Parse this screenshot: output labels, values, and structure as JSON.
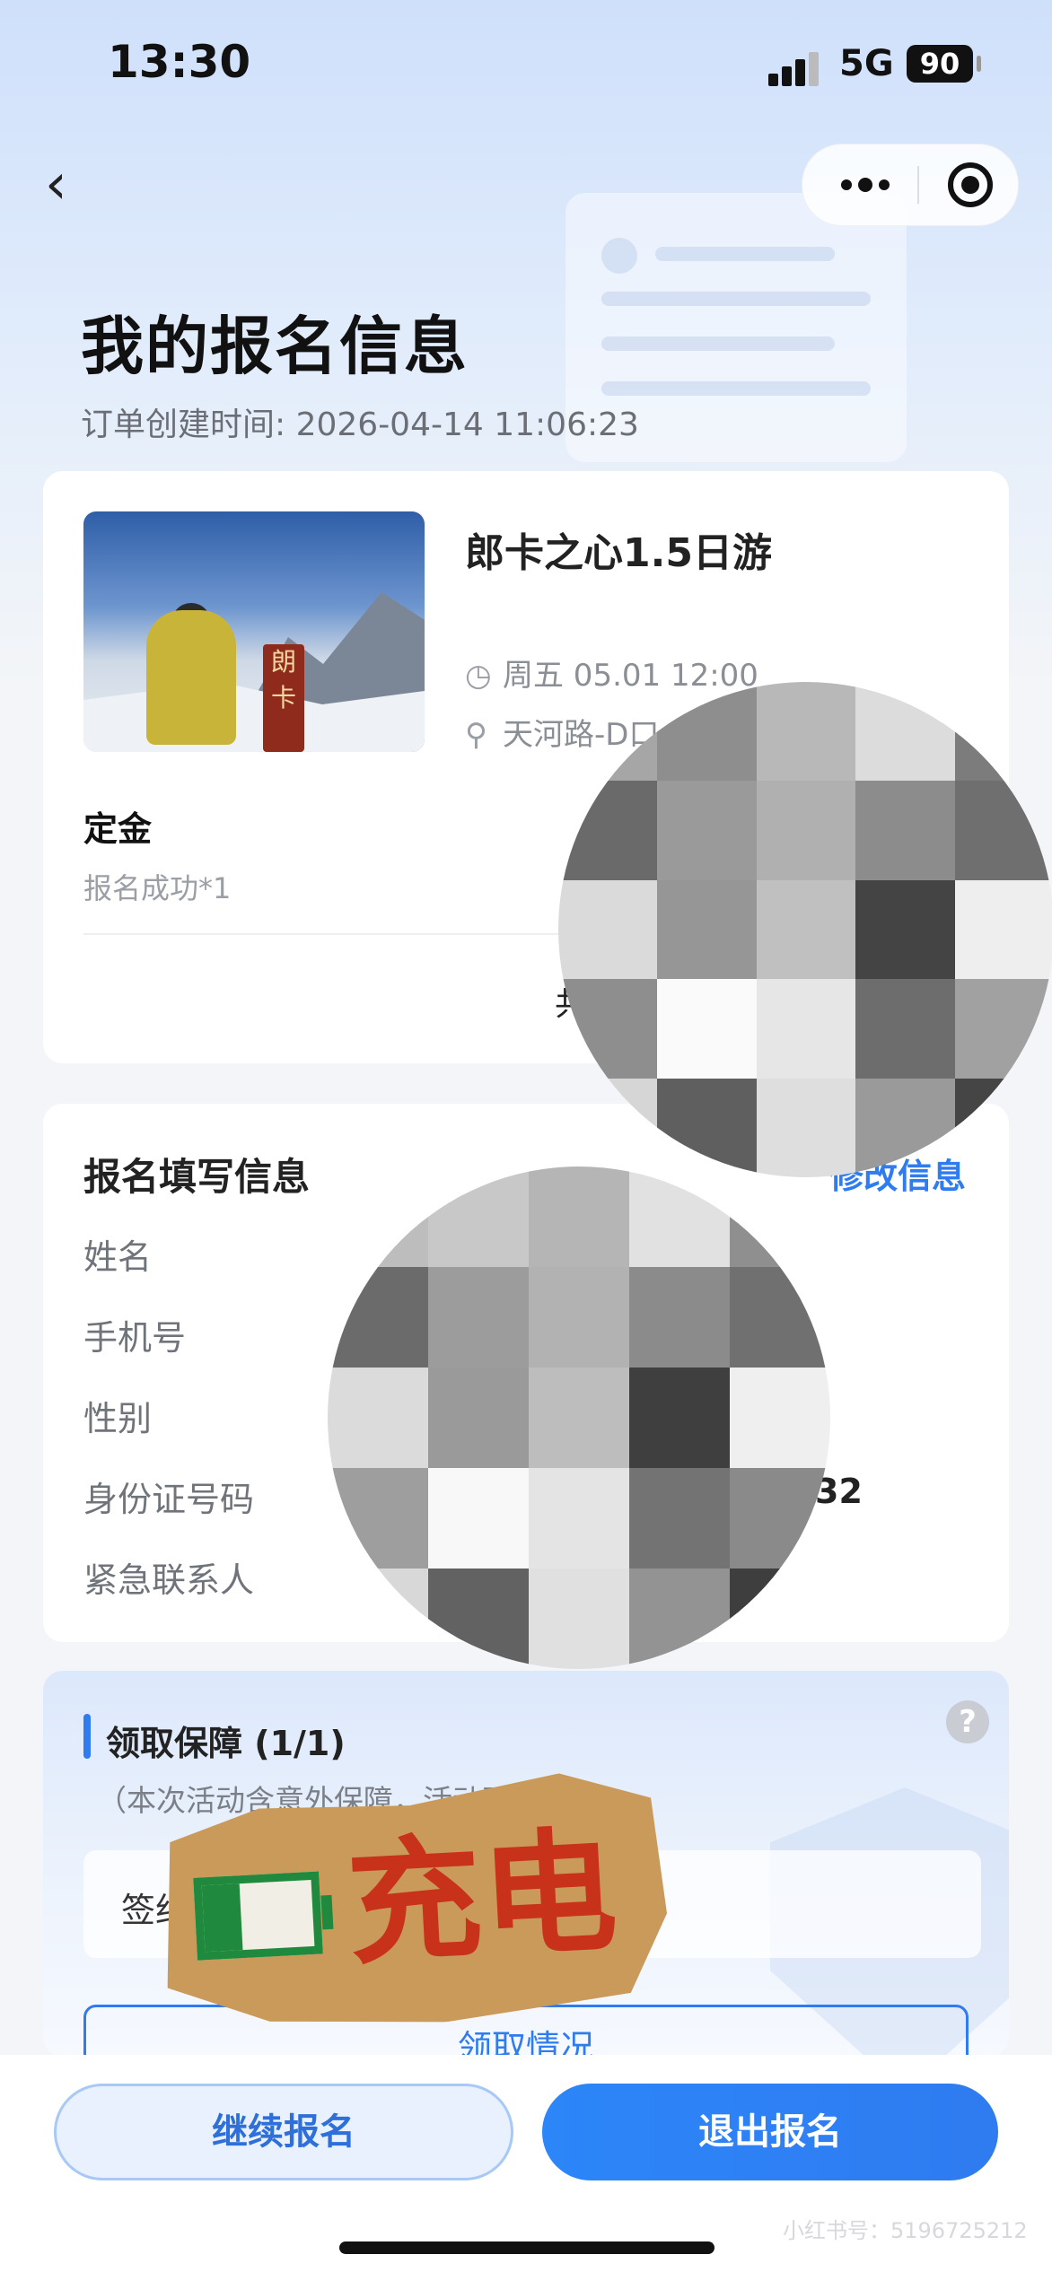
{
  "status_bar": {
    "time": "13:30",
    "network": "5G",
    "battery": "90"
  },
  "nav": {
    "back_icon": "chevron-left-icon",
    "more_icon": "more-dots-icon",
    "close_icon": "target-icon"
  },
  "page": {
    "title": "我的报名信息",
    "order_time": "订单创建时间: 2026-04-14 11:06:23"
  },
  "trip": {
    "name": "郎卡之心1.5日游",
    "date": "周五 05.01 12:00",
    "location": "天河路-D口",
    "photo_sign_text": "朗\n卡",
    "item_title": "定金",
    "item_status": "报名成功*1",
    "total_prefix": "共"
  },
  "form": {
    "title": "报名填写信息",
    "edit_label": "修改信息",
    "fields": [
      {
        "label": "姓名",
        "value": ""
      },
      {
        "label": "手机号",
        "value": ""
      },
      {
        "label": "性别",
        "value": ""
      },
      {
        "label": "身份证号码",
        "value": "32"
      },
      {
        "label": "紧急联系人",
        "value": ""
      }
    ]
  },
  "guarantee": {
    "title": "领取保障 (1/1)",
    "subtitle": "（本次活动含意外保障，活动更放心）",
    "sign_label": "签约",
    "claim_button": "领取情况",
    "help_icon": "?"
  },
  "sticker": {
    "text": "充电"
  },
  "actions": {
    "continue_label": "继续报名",
    "quit_label": "退出报名"
  },
  "watermark": "小红书号：5196725212"
}
